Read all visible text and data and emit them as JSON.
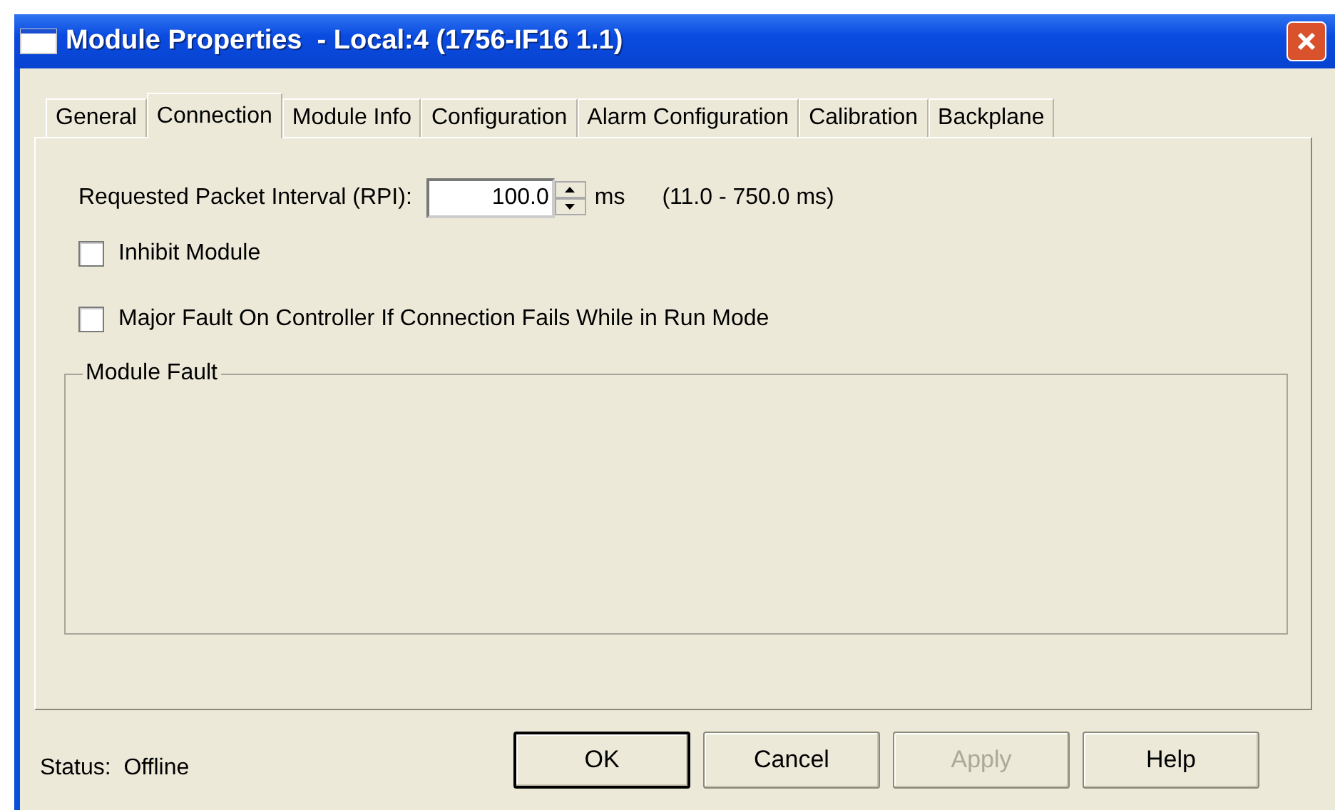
{
  "window": {
    "title": "Module Properties  - Local:4 (1756-IF16 1.1)"
  },
  "tabs": [
    {
      "label": "General",
      "selected": false
    },
    {
      "label": "Connection",
      "selected": true
    },
    {
      "label": "Module Info",
      "selected": false
    },
    {
      "label": "Configuration",
      "selected": false
    },
    {
      "label": "Alarm Configuration",
      "selected": false
    },
    {
      "label": "Calibration",
      "selected": false
    },
    {
      "label": "Backplane",
      "selected": false
    }
  ],
  "rpi": {
    "label": "Requested Packet Interval (RPI):",
    "value": "100.0",
    "unit": "ms",
    "range": "(11.0 - 750.0 ms)"
  },
  "options": [
    {
      "label": "Inhibit Module",
      "checked": false
    },
    {
      "label": "Major Fault On Controller If Connection Fails While in Run Mode",
      "checked": false
    }
  ],
  "module_fault": {
    "title": "Module Fault"
  },
  "status": {
    "label": "Status:",
    "value": "Offline"
  },
  "buttons": [
    {
      "label": "OK",
      "default": true,
      "disabled": false
    },
    {
      "label": "Cancel",
      "default": false,
      "disabled": false
    },
    {
      "label": "Apply",
      "default": false,
      "disabled": true
    },
    {
      "label": "Help",
      "default": false,
      "disabled": false
    }
  ]
}
